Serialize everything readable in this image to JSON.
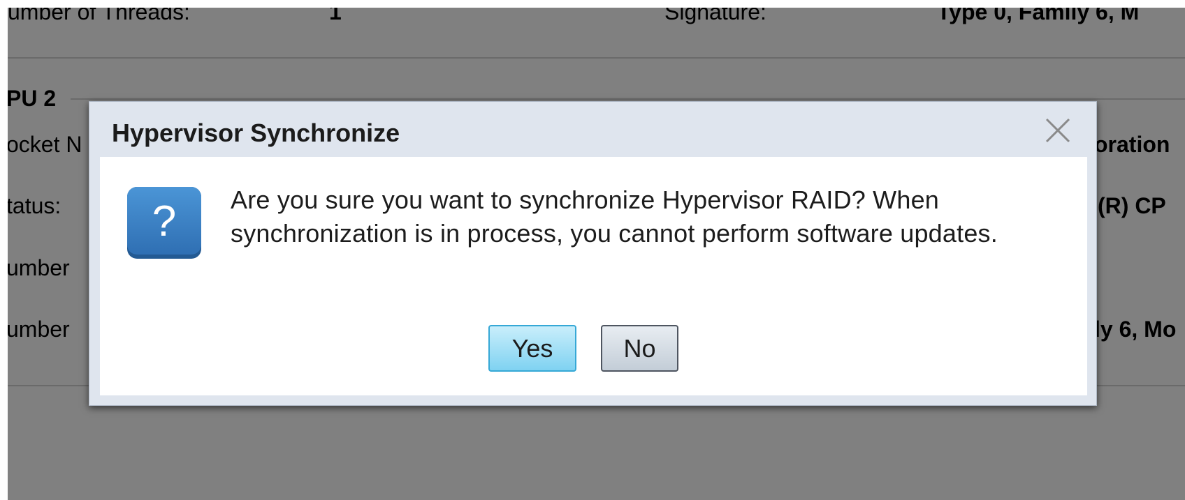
{
  "background": {
    "row1_left_label": "umber of Threads:",
    "row1_left_value": "1",
    "row1_right_label": "Signature:",
    "row1_right_value": "Type 0, Family 6, M",
    "section_title": "PU 2",
    "left_labels": [
      "ocket N",
      "tatus:",
      "umber",
      "umber"
    ],
    "right_values": [
      "oration",
      "(R) CP",
      "",
      "ly 6, Mo"
    ]
  },
  "dialog": {
    "title": "Hypervisor Synchronize",
    "message": "Are you sure you want to synchronize Hypervisor RAID? When synchronization is in process, you cannot perform software updates.",
    "yes_label": "Yes",
    "no_label": "No",
    "icon": "question-icon",
    "close_icon": "close-icon"
  },
  "colors": {
    "overlay": "#808080",
    "dialog_frame": "#dfe5ee",
    "question_icon": "#3d84c8",
    "yes_button": "#7fd2f1"
  }
}
